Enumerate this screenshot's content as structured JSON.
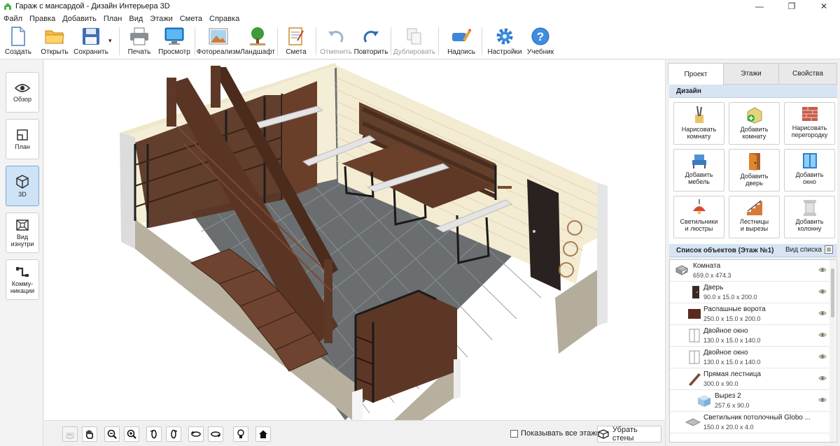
{
  "window": {
    "title": "Гараж с мансардой - Дизайн Интерьера 3D",
    "controls": [
      "—",
      "❐",
      "✕"
    ]
  },
  "menu": [
    "Файл",
    "Правка",
    "Добавить",
    "План",
    "Вид",
    "Этажи",
    "Смета",
    "Справка"
  ],
  "toolbar": {
    "create": "Создать",
    "open": "Открыть",
    "save": "Сохранить",
    "save_arrow": "▾",
    "print": "Печать",
    "preview": "Просмотр",
    "photoreal": "Фотореализм",
    "landscape": "Ландшафт",
    "estimate": "Смета",
    "undo": "Отменить",
    "redo": "Повторить",
    "duplicate": "Дублировать",
    "caption": "Надпись",
    "settings": "Настройки",
    "tutorial": "Учебник"
  },
  "leftnav": {
    "overview": "Обзор",
    "plan": "План",
    "view3d": "3D",
    "inside": "Вид\nизнутри",
    "utilities": "Комму-\nникации"
  },
  "bottombar": {
    "show_all_floors": "Показывать все этажи",
    "remove_walls": "Убрать стены"
  },
  "rightpanel": {
    "tabs": [
      "Проект",
      "Этажи",
      "Свойства"
    ],
    "design_head": "Дизайн",
    "design_buttons": [
      "Нарисовать\nкомнату",
      "Добавить\nкомнату",
      "Нарисовать\nперегородку",
      "Добавить\nмебель",
      "Добавить\nдверь",
      "Добавить\nокно",
      "Светильники\nи люстры",
      "Лестницы\nи вырезы",
      "Добавить\nколонну"
    ],
    "list_head": "Список объектов (Этаж №1)",
    "list_view": "Вид списка",
    "objects": [
      {
        "name": "Комната",
        "dims": "659.0 x 474.3"
      },
      {
        "name": "Дверь",
        "dims": "90.0 x 15.0 x 200.0"
      },
      {
        "name": "Распашные ворота",
        "dims": "250.0 x 15.0 x 200.0"
      },
      {
        "name": "Двойное окно",
        "dims": "130.0 x 15.0 x 140.0"
      },
      {
        "name": "Двойное окно",
        "dims": "130.0 x 15.0 x 140.0"
      },
      {
        "name": "Прямая лестница",
        "dims": "300.0 x 90.0"
      },
      {
        "name": "Вырез 2",
        "dims": "257.6 x 90.0"
      },
      {
        "name": "Светильник потолочный Globo ...",
        "dims": "150.0 x 20.0 x 4.0"
      }
    ]
  },
  "colors": {
    "accent": "#cfe3f7",
    "section_head": "#d7e4f3",
    "wood": "#5a3423",
    "floor": "#6a6e70",
    "wall_cream": "#f3ecd2"
  }
}
